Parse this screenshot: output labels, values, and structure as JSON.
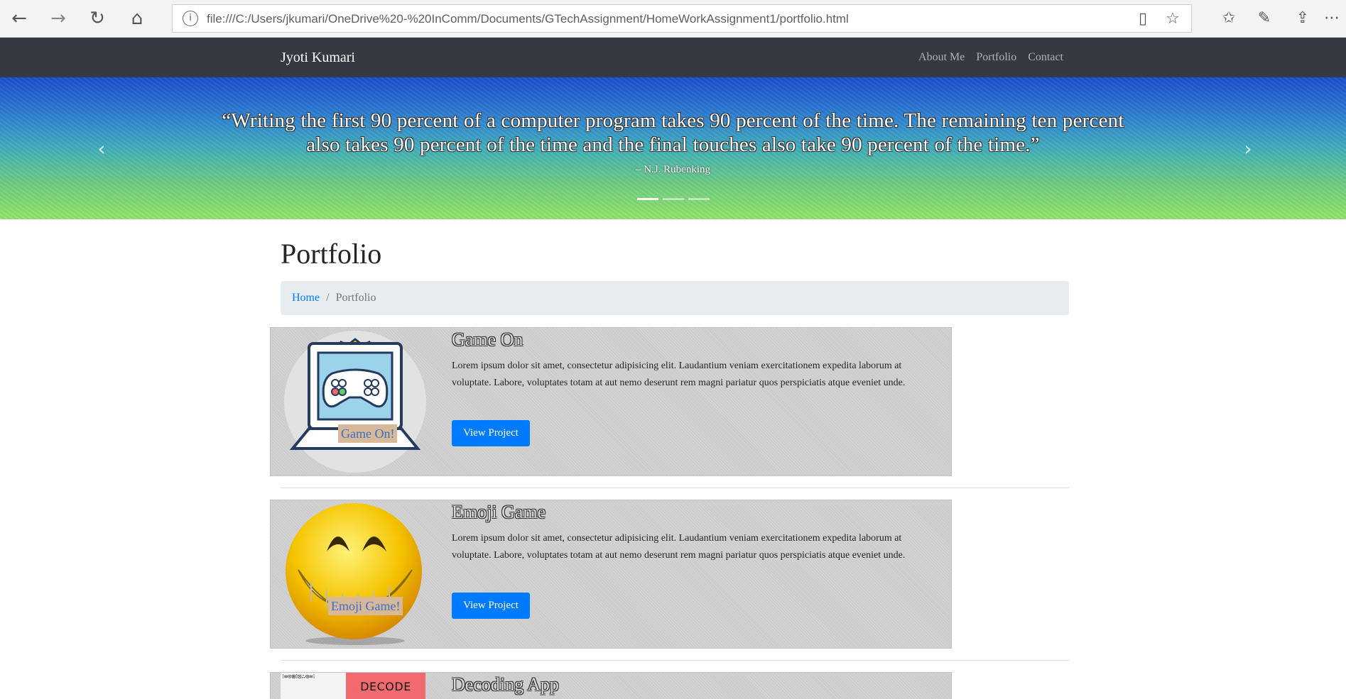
{
  "browser": {
    "url": "file:///C:/Users/jkumari/OneDrive%20-%20InComm/Documents/GTechAssignment/HomeWorkAssignment1/portfolio.html",
    "icons": {
      "back": "back-arrow-icon",
      "forward": "forward-arrow-icon",
      "refresh": "refresh-icon",
      "home": "home-icon",
      "info": "info-icon",
      "reading_view": "reading-view-icon",
      "favorite": "star-icon",
      "favorites_list": "favorites-list-icon",
      "notes": "pen-icon",
      "share": "share-icon",
      "more": "more-icon"
    },
    "info_glyph": "i"
  },
  "navbar": {
    "brand": "Jyoti Kumari",
    "links": [
      "About Me",
      "Portfolio",
      "Contact"
    ]
  },
  "carousel": {
    "quote_line1": "“Writing the first 90 percent of a computer program takes 90 percent of the time. The remaining ten percent",
    "quote_line2": "also takes 90 percent of the time and the final touches also take 90 percent of the time.”",
    "author": "– N.J. Rubenking",
    "slides": 3,
    "active_slide": 1
  },
  "page": {
    "title": "Portfolio",
    "breadcrumb": {
      "home": "Home",
      "separator": "/",
      "current": "Portfolio"
    }
  },
  "projects": [
    {
      "title": "Game On",
      "description": "Lorem ipsum dolor sit amet, consectetur adipisicing elit. Laudantium veniam exercitationem expedita laborum at voluptate. Labore, voluptates totam at aut nemo deserunt rem magni pariatur quos perspiciatis atque eveniet unde.",
      "button": "View Project",
      "image_caption": "Game On!"
    },
    {
      "title": "Emoji Game",
      "description": "Lorem ipsum dolor sit amet, consectetur adipisicing elit. Laudantium veniam exercitationem expedita laborum at voluptate. Labore, voluptates totam at aut nemo deserunt rem magni pariatur quos perspiciatis atque eveniet unde.",
      "button": "View Project",
      "image_caption": "Emoji Game!"
    },
    {
      "title": "Decoding App",
      "image_caption": "DECODE YOUR",
      "image_glyphs": "⁝∞⊙⊞⁝⊡∴⊙∞⁝"
    }
  ],
  "colors": {
    "navbar_bg": "#343a40",
    "primary": "#007bff",
    "card_bg": "#d3d3d3",
    "breadcrumb_bg": "#e9ecef"
  }
}
